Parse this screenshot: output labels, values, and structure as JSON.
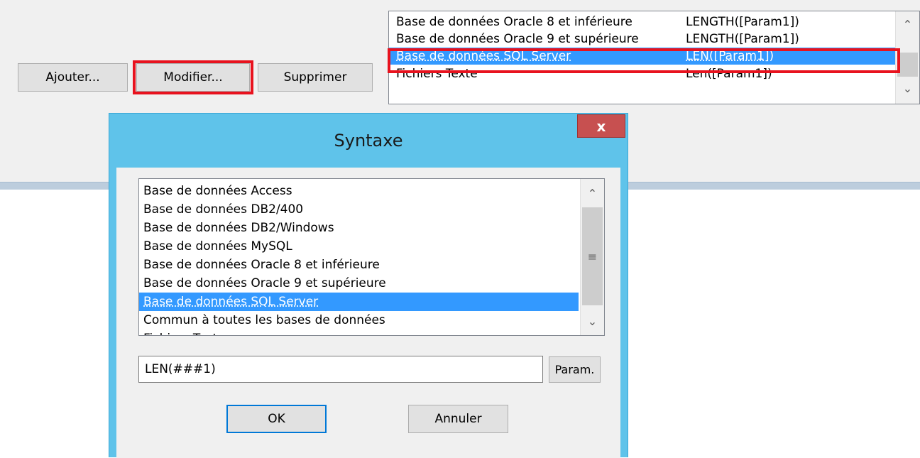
{
  "toolbar": {
    "add_label": "Ajouter...",
    "edit_label": "Modifier...",
    "delete_label": "Supprimer"
  },
  "syntax_table": {
    "rows": [
      {
        "database": "Base de données Oracle 8 et inférieure",
        "syntax": "LENGTH([Param1])"
      },
      {
        "database": "Base de données Oracle 9 et supérieure",
        "syntax": "LENGTH([Param1])"
      },
      {
        "database": "Base de données SQL Server",
        "syntax": "LEN([Param1])",
        "selected": true
      },
      {
        "database": "Fichiers Texte",
        "syntax": "Len([Param1])"
      }
    ]
  },
  "dialog": {
    "title": "Syntaxe",
    "close_label": "x",
    "databases": [
      "Base de données Access",
      "Base de données DB2/400",
      "Base de données DB2/Windows",
      "Base de données MySQL",
      "Base de données Oracle 8 et inférieure",
      "Base de données Oracle 9 et supérieure",
      "Base de données SQL Server",
      "Commun à toutes les bases de données",
      "Fichiers Texte"
    ],
    "selected_database": "Base de données SQL Server",
    "syntax_value": "LEN(###1)",
    "param_label": "Param.",
    "ok_label": "OK",
    "cancel_label": "Annuler"
  },
  "icons": {
    "scroll_up": "scroll-up-arrow-icon",
    "scroll_down": "scroll-down-arrow-icon",
    "scroll_grip": "scroll-grip-icon"
  },
  "colors": {
    "highlight": "#e8121e",
    "selection": "#3399ff",
    "dialog_frame": "#5fc3ea",
    "close_button": "#c75050"
  }
}
